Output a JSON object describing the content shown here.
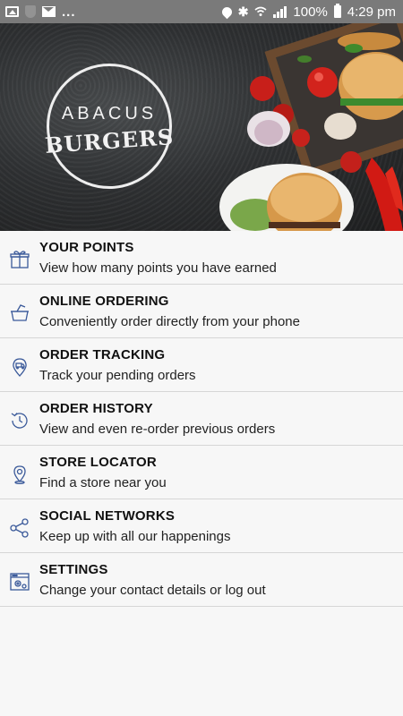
{
  "status_bar": {
    "icons": [
      "image-icon",
      "shield-icon",
      "mail-icon",
      "more-dots"
    ],
    "more": "...",
    "right_icons": [
      "location-icon",
      "bluetooth-icon",
      "wifi-icon",
      "signal-icon"
    ],
    "battery": "100%",
    "time": "4:29 pm"
  },
  "banner": {
    "logo_line1": "ABACUS",
    "logo_line2": "BURGERS"
  },
  "menu": {
    "items": [
      {
        "icon": "gift-icon",
        "title": "YOUR POINTS",
        "subtitle": "View how many points you have earned"
      },
      {
        "icon": "basket-icon",
        "title": "ONLINE ORDERING",
        "subtitle": "Conveniently order directly from your phone"
      },
      {
        "icon": "delivery-pin-icon",
        "title": "ORDER TRACKING",
        "subtitle": "Track your pending orders"
      },
      {
        "icon": "history-icon",
        "title": "ORDER HISTORY",
        "subtitle": "View and even re-order previous orders"
      },
      {
        "icon": "location-pin-icon",
        "title": "STORE LOCATOR",
        "subtitle": "Find a store near you"
      },
      {
        "icon": "share-icon",
        "title": "SOCIAL NETWORKS",
        "subtitle": "Keep up with all our happenings"
      },
      {
        "icon": "settings-window-icon",
        "title": "SETTINGS",
        "subtitle": "Change your contact details or log out"
      }
    ]
  },
  "colors": {
    "status_bar": "#7a7a7a",
    "icon_accent": "#3b5a9a",
    "divider": "#d6d6d6",
    "background": "#f7f7f7"
  }
}
